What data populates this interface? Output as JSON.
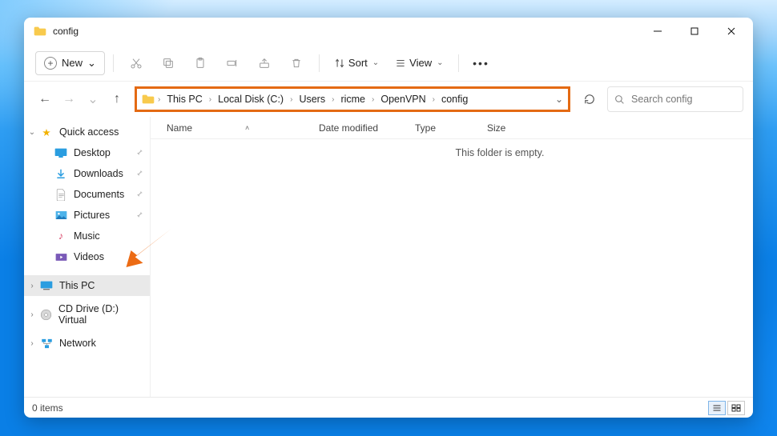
{
  "window": {
    "title": "config"
  },
  "toolbar": {
    "new_label": "New",
    "sort_label": "Sort",
    "view_label": "View"
  },
  "breadcrumb": {
    "items": [
      "This PC",
      "Local Disk (C:)",
      "Users",
      "ricme",
      "OpenVPN",
      "config"
    ]
  },
  "search": {
    "placeholder": "Search config"
  },
  "sidebar": {
    "quick_access": "Quick access",
    "items": [
      {
        "label": "Desktop",
        "pinned": true
      },
      {
        "label": "Downloads",
        "pinned": true
      },
      {
        "label": "Documents",
        "pinned": true
      },
      {
        "label": "Pictures",
        "pinned": true
      },
      {
        "label": "Music",
        "pinned": false
      },
      {
        "label": "Videos",
        "pinned": false
      }
    ],
    "this_pc": "This PC",
    "cd_drive": "CD Drive (D:) Virtual",
    "network": "Network"
  },
  "columns": {
    "name": "Name",
    "date": "Date modified",
    "type": "Type",
    "size": "Size"
  },
  "main": {
    "empty_text": "This folder is empty."
  },
  "status": {
    "item_count": "0 items"
  }
}
